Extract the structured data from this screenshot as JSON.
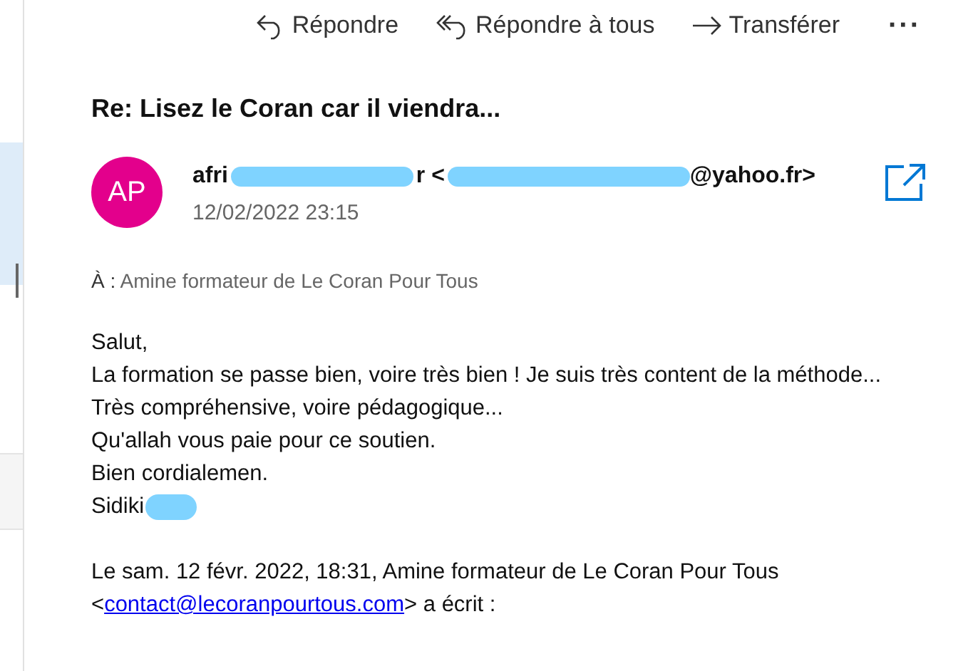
{
  "toolbar": [
    {
      "kind": "reply",
      "label": "Répondre"
    },
    {
      "kind": "reply-all",
      "label": "Répondre à tous"
    },
    {
      "kind": "forward",
      "label": "Transférer"
    },
    {
      "kind": "more",
      "label": "···"
    }
  ],
  "message": {
    "subject": "Re: Lisez le Coran car il viendra...",
    "avatar": {
      "initials": "AP",
      "color": "#e3008c"
    },
    "sender_parts": [
      "afri",
      "r <",
      "@yahoo.fr>"
    ],
    "date": "12/02/2022 23:15",
    "to_label": "À :",
    "to": "Amine formateur de Le Coran Pour Tous",
    "body_lines": [
      "Salut,",
      "La formation se passe bien, voire très bien ! Je suis très content de la méthode...",
      "Très compréhensive, voire pédagogique...",
      "Qu'allah vous paie pour ce soutien.",
      "Bien cordialemen."
    ],
    "signature": "Sidiki",
    "quote_line": "Le sam. 12 févr. 2022, 18:31, Amine formateur de Le Coran Pour Tous",
    "quote_open": "<",
    "quote_link": "contact@lecoranpourtous.com",
    "quote_close": "> a écrit :"
  }
}
